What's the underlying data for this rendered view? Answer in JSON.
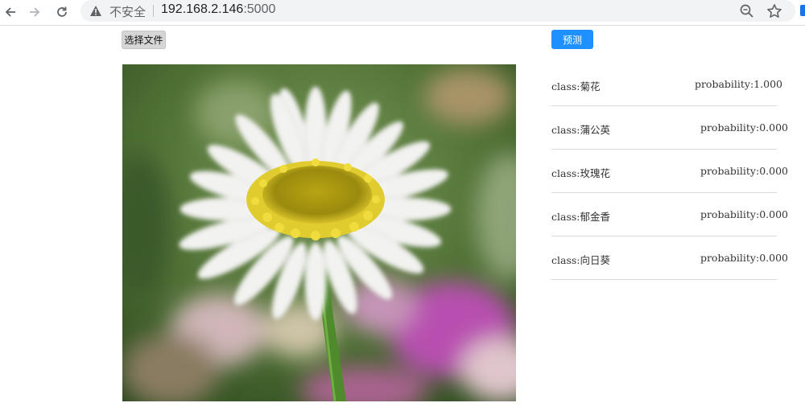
{
  "browser": {
    "security_label": "不安全",
    "url_host": "192.168.2.146",
    "url_port": ":5000"
  },
  "page": {
    "file_button_label": "选择文件",
    "predict_button_label": "预测",
    "results": [
      {
        "class_text": "class:菊花",
        "prob_text": "probability:1.000"
      },
      {
        "class_text": "class:蒲公英",
        "prob_text": "probability:0.000"
      },
      {
        "class_text": "class:玫瑰花",
        "prob_text": "probability:0.000"
      },
      {
        "class_text": "class:郁金香",
        "prob_text": "probability:0.000"
      },
      {
        "class_text": "class:向日葵",
        "prob_text": "probability:0.000"
      }
    ]
  },
  "colors": {
    "accent": "#1e90ff",
    "divider": "#d9d9d9"
  }
}
